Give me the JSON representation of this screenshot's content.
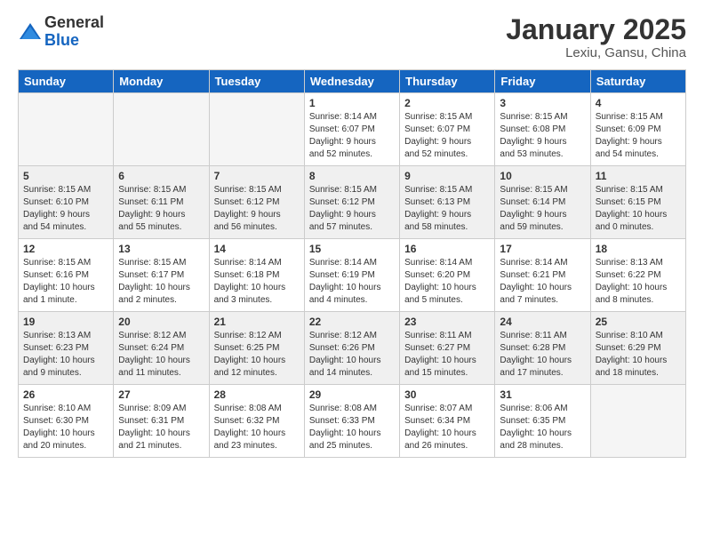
{
  "header": {
    "logo_general": "General",
    "logo_blue": "Blue",
    "month_title": "January 2025",
    "location": "Lexiu, Gansu, China"
  },
  "days_of_week": [
    "Sunday",
    "Monday",
    "Tuesday",
    "Wednesday",
    "Thursday",
    "Friday",
    "Saturday"
  ],
  "weeks": [
    {
      "shaded": false,
      "days": [
        {
          "num": "",
          "info": ""
        },
        {
          "num": "",
          "info": ""
        },
        {
          "num": "",
          "info": ""
        },
        {
          "num": "1",
          "info": "Sunrise: 8:14 AM\nSunset: 6:07 PM\nDaylight: 9 hours\nand 52 minutes."
        },
        {
          "num": "2",
          "info": "Sunrise: 8:15 AM\nSunset: 6:07 PM\nDaylight: 9 hours\nand 52 minutes."
        },
        {
          "num": "3",
          "info": "Sunrise: 8:15 AM\nSunset: 6:08 PM\nDaylight: 9 hours\nand 53 minutes."
        },
        {
          "num": "4",
          "info": "Sunrise: 8:15 AM\nSunset: 6:09 PM\nDaylight: 9 hours\nand 54 minutes."
        }
      ]
    },
    {
      "shaded": true,
      "days": [
        {
          "num": "5",
          "info": "Sunrise: 8:15 AM\nSunset: 6:10 PM\nDaylight: 9 hours\nand 54 minutes."
        },
        {
          "num": "6",
          "info": "Sunrise: 8:15 AM\nSunset: 6:11 PM\nDaylight: 9 hours\nand 55 minutes."
        },
        {
          "num": "7",
          "info": "Sunrise: 8:15 AM\nSunset: 6:12 PM\nDaylight: 9 hours\nand 56 minutes."
        },
        {
          "num": "8",
          "info": "Sunrise: 8:15 AM\nSunset: 6:12 PM\nDaylight: 9 hours\nand 57 minutes."
        },
        {
          "num": "9",
          "info": "Sunrise: 8:15 AM\nSunset: 6:13 PM\nDaylight: 9 hours\nand 58 minutes."
        },
        {
          "num": "10",
          "info": "Sunrise: 8:15 AM\nSunset: 6:14 PM\nDaylight: 9 hours\nand 59 minutes."
        },
        {
          "num": "11",
          "info": "Sunrise: 8:15 AM\nSunset: 6:15 PM\nDaylight: 10 hours\nand 0 minutes."
        }
      ]
    },
    {
      "shaded": false,
      "days": [
        {
          "num": "12",
          "info": "Sunrise: 8:15 AM\nSunset: 6:16 PM\nDaylight: 10 hours\nand 1 minute."
        },
        {
          "num": "13",
          "info": "Sunrise: 8:15 AM\nSunset: 6:17 PM\nDaylight: 10 hours\nand 2 minutes."
        },
        {
          "num": "14",
          "info": "Sunrise: 8:14 AM\nSunset: 6:18 PM\nDaylight: 10 hours\nand 3 minutes."
        },
        {
          "num": "15",
          "info": "Sunrise: 8:14 AM\nSunset: 6:19 PM\nDaylight: 10 hours\nand 4 minutes."
        },
        {
          "num": "16",
          "info": "Sunrise: 8:14 AM\nSunset: 6:20 PM\nDaylight: 10 hours\nand 5 minutes."
        },
        {
          "num": "17",
          "info": "Sunrise: 8:14 AM\nSunset: 6:21 PM\nDaylight: 10 hours\nand 7 minutes."
        },
        {
          "num": "18",
          "info": "Sunrise: 8:13 AM\nSunset: 6:22 PM\nDaylight: 10 hours\nand 8 minutes."
        }
      ]
    },
    {
      "shaded": true,
      "days": [
        {
          "num": "19",
          "info": "Sunrise: 8:13 AM\nSunset: 6:23 PM\nDaylight: 10 hours\nand 9 minutes."
        },
        {
          "num": "20",
          "info": "Sunrise: 8:12 AM\nSunset: 6:24 PM\nDaylight: 10 hours\nand 11 minutes."
        },
        {
          "num": "21",
          "info": "Sunrise: 8:12 AM\nSunset: 6:25 PM\nDaylight: 10 hours\nand 12 minutes."
        },
        {
          "num": "22",
          "info": "Sunrise: 8:12 AM\nSunset: 6:26 PM\nDaylight: 10 hours\nand 14 minutes."
        },
        {
          "num": "23",
          "info": "Sunrise: 8:11 AM\nSunset: 6:27 PM\nDaylight: 10 hours\nand 15 minutes."
        },
        {
          "num": "24",
          "info": "Sunrise: 8:11 AM\nSunset: 6:28 PM\nDaylight: 10 hours\nand 17 minutes."
        },
        {
          "num": "25",
          "info": "Sunrise: 8:10 AM\nSunset: 6:29 PM\nDaylight: 10 hours\nand 18 minutes."
        }
      ]
    },
    {
      "shaded": false,
      "days": [
        {
          "num": "26",
          "info": "Sunrise: 8:10 AM\nSunset: 6:30 PM\nDaylight: 10 hours\nand 20 minutes."
        },
        {
          "num": "27",
          "info": "Sunrise: 8:09 AM\nSunset: 6:31 PM\nDaylight: 10 hours\nand 21 minutes."
        },
        {
          "num": "28",
          "info": "Sunrise: 8:08 AM\nSunset: 6:32 PM\nDaylight: 10 hours\nand 23 minutes."
        },
        {
          "num": "29",
          "info": "Sunrise: 8:08 AM\nSunset: 6:33 PM\nDaylight: 10 hours\nand 25 minutes."
        },
        {
          "num": "30",
          "info": "Sunrise: 8:07 AM\nSunset: 6:34 PM\nDaylight: 10 hours\nand 26 minutes."
        },
        {
          "num": "31",
          "info": "Sunrise: 8:06 AM\nSunset: 6:35 PM\nDaylight: 10 hours\nand 28 minutes."
        },
        {
          "num": "",
          "info": ""
        }
      ]
    }
  ]
}
